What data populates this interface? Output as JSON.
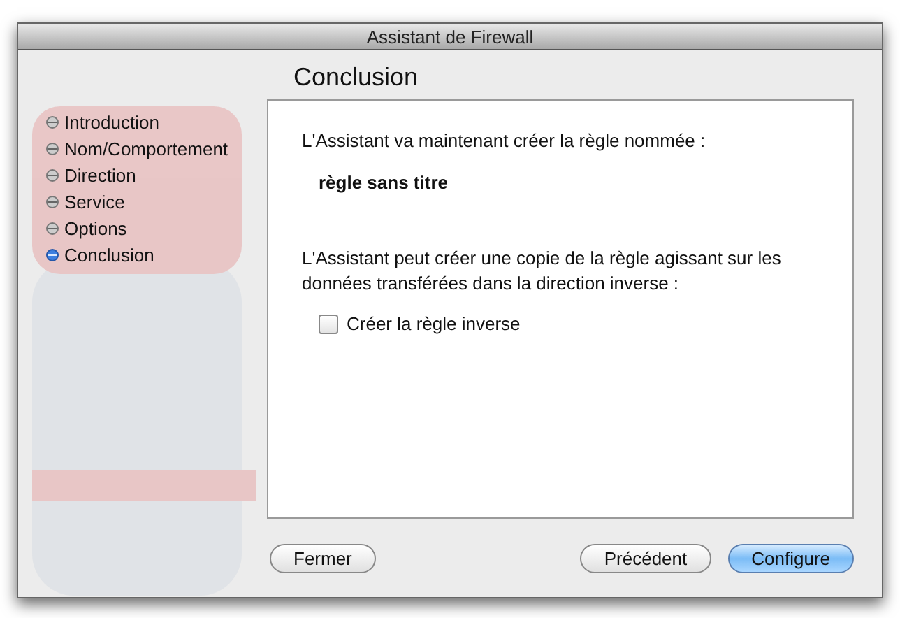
{
  "window": {
    "title": "Assistant de Firewall"
  },
  "heading": "Conclusion",
  "steps": [
    {
      "label": "Introduction",
      "selected": false
    },
    {
      "label": "Nom/Comportement",
      "selected": false
    },
    {
      "label": "Direction",
      "selected": false
    },
    {
      "label": "Service",
      "selected": false
    },
    {
      "label": "Options",
      "selected": false
    },
    {
      "label": "Conclusion",
      "selected": true
    }
  ],
  "panel": {
    "intro": "L'Assistant va maintenant créer la règle nommée :",
    "rule_name": "règle sans titre",
    "copy_text": "L'Assistant peut créer une copie de la règle agissant sur les données transférées dans la direction inverse :",
    "checkbox": {
      "label": "Créer la règle inverse",
      "checked": false
    }
  },
  "left_buttons": [
    {
      "label": "Fermer",
      "default": false
    }
  ],
  "right_buttons": [
    {
      "label": "Précédent",
      "default": false
    },
    {
      "label": "Configure",
      "default": true
    }
  ]
}
